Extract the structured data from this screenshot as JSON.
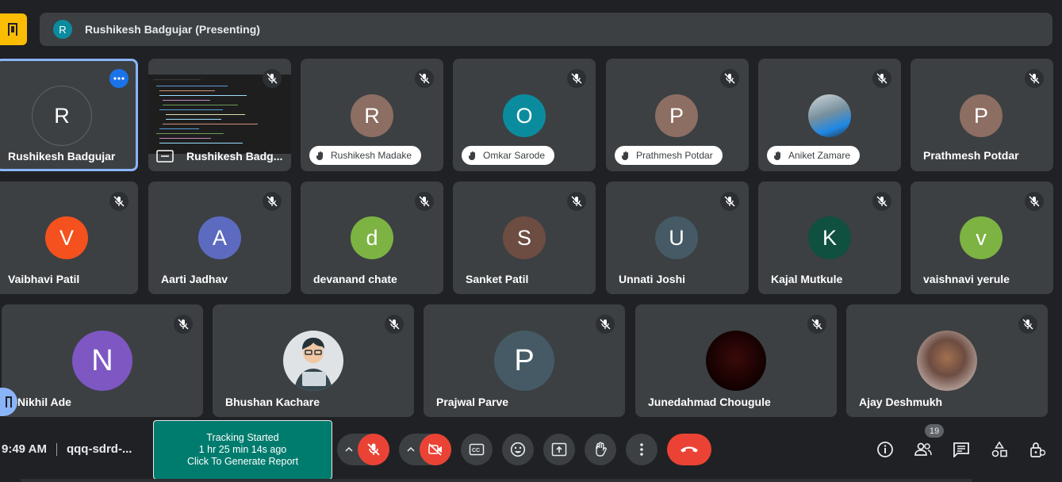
{
  "banner": {
    "avatar_letter": "R",
    "text": "Rushikesh Badgujar (Presenting)"
  },
  "colors": {
    "accent_blue": "#8ab4f8",
    "danger_red": "#ea4335",
    "tracking_green": "#007c6e",
    "warning_yellow": "#fbbc04"
  },
  "tiles_row1": [
    {
      "name": "Rushikesh Badgujar",
      "letter": "R",
      "color": "#0b8c9e"
    },
    {
      "name": "Rushikesh Badg..."
    },
    {
      "name": "Rushikesh Madake",
      "letter": "R",
      "color": "#8d6e63"
    },
    {
      "name": "Omkar Sarode",
      "letter": "O",
      "color": "#0b8c9e"
    },
    {
      "name": "Prathmesh Potdar",
      "letter": "P",
      "color": "#8d6e63"
    },
    {
      "name": "Aniket Zamare"
    },
    {
      "name": "Prathmesh Potdar",
      "letter": "P",
      "color": "#8d6e63"
    }
  ],
  "tiles_row2": [
    {
      "name": "Vaibhavi Patil",
      "letter": "V",
      "color": "#f4511e"
    },
    {
      "name": "Aarti Jadhav",
      "letter": "A",
      "color": "#5c6bc0"
    },
    {
      "name": "devanand chate",
      "letter": "d",
      "color": "#7cb342"
    },
    {
      "name": "Sanket Patil",
      "letter": "S",
      "color": "#6d4c41"
    },
    {
      "name": "Unnati Joshi",
      "letter": "U",
      "color": "#455a64"
    },
    {
      "name": "Kajal Mutkule",
      "letter": "K",
      "color": "#0f5040"
    },
    {
      "name": "vaishnavi yerule",
      "letter": "v",
      "color": "#7cb342"
    }
  ],
  "tiles_row3": [
    {
      "name": "Nikhil Ade",
      "letter": "N",
      "color": "#7e57c2"
    },
    {
      "name": "Bhushan Kachare"
    },
    {
      "name": "Prajwal Parve",
      "letter": "P",
      "color": "#455a64"
    },
    {
      "name": "Junedahmad Chougule"
    },
    {
      "name": "Ajay Deshmukh"
    }
  ],
  "bottom": {
    "time": "9:49 AM",
    "meeting_code": "qqq-sdrd-...",
    "tracking": {
      "line1": "Tracking Started",
      "line2": "1 hr 25 min 14s ago",
      "line3": "Click To Generate Report"
    },
    "participants_count": "19"
  },
  "icons": {
    "banner": "presentation-icon",
    "tile_mute": "mic-off-icon",
    "raised_hand": "hand-icon",
    "more": "more-horiz-icon",
    "present_frame": "present-screen-icon",
    "controls": [
      "chevron-up-icon",
      "mic-off-icon",
      "chevron-up-icon",
      "videocam-off-icon",
      "captions-icon",
      "emoji-icon",
      "present-icon",
      "raise-hand-icon",
      "more-vert-icon",
      "call-end-icon"
    ],
    "right": [
      "info-icon",
      "people-icon",
      "chat-icon",
      "activities-icon",
      "host-controls-icon"
    ]
  }
}
